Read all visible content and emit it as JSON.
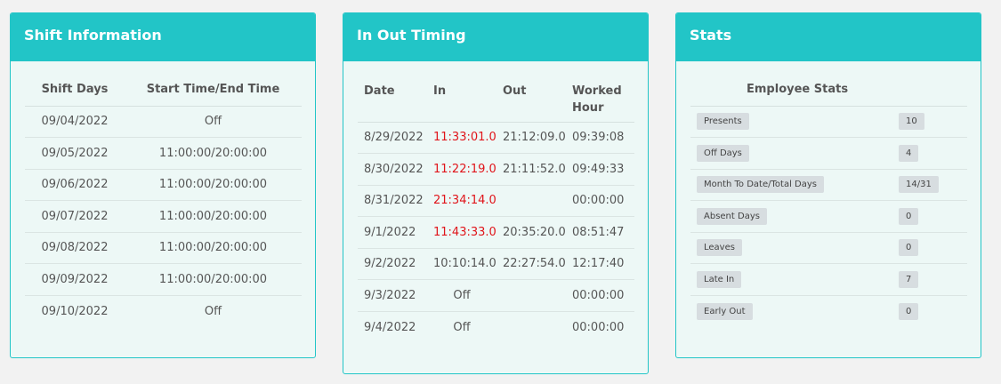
{
  "shift": {
    "title": "Shift Information",
    "columns": [
      "Shift Days",
      "Start Time/End Time"
    ],
    "rows": [
      [
        "09/04/2022",
        "Off"
      ],
      [
        "09/05/2022",
        "11:00:00/20:00:00"
      ],
      [
        "09/06/2022",
        "11:00:00/20:00:00"
      ],
      [
        "09/07/2022",
        "11:00:00/20:00:00"
      ],
      [
        "09/08/2022",
        "11:00:00/20:00:00"
      ],
      [
        "09/09/2022",
        "11:00:00/20:00:00"
      ],
      [
        "09/10/2022",
        "Off"
      ]
    ]
  },
  "timing": {
    "title": "In Out Timing",
    "columns": [
      "Date",
      "In",
      "Out",
      "Worked Hour"
    ],
    "rows": [
      [
        "8/29/2022",
        "11:33:01.0",
        "21:12:09.0",
        "09:39:08"
      ],
      [
        "8/30/2022",
        "11:22:19.0",
        "21:11:52.0",
        "09:49:33"
      ],
      [
        "8/31/2022",
        "21:34:14.0",
        "",
        "00:00:00"
      ],
      [
        "9/1/2022",
        "11:43:33.0",
        "20:35:20.0",
        "08:51:47"
      ],
      [
        "9/2/2022",
        "10:10:14.0",
        "22:27:54.0",
        "12:17:40"
      ],
      [
        "9/3/2022",
        "Off",
        "",
        "00:00:00"
      ],
      [
        "9/4/2022",
        "Off",
        "",
        "00:00:00"
      ]
    ],
    "late_color": "#e0141a"
  },
  "stats": {
    "title": "Stats",
    "header": "Employee Stats",
    "rows": [
      [
        "Presents",
        "10"
      ],
      [
        "Off Days",
        "4"
      ],
      [
        "Month To Date/Total Days",
        "14/31"
      ],
      [
        "Absent Days",
        "0"
      ],
      [
        "Leaves",
        "0"
      ],
      [
        "Late In",
        "7"
      ],
      [
        "Early Out",
        "0"
      ]
    ]
  },
  "colors": {
    "accent": "#22c5c7",
    "panel_bg": "#edf8f6",
    "late": "#e0141a",
    "badge_bg": "#d7dde0"
  }
}
